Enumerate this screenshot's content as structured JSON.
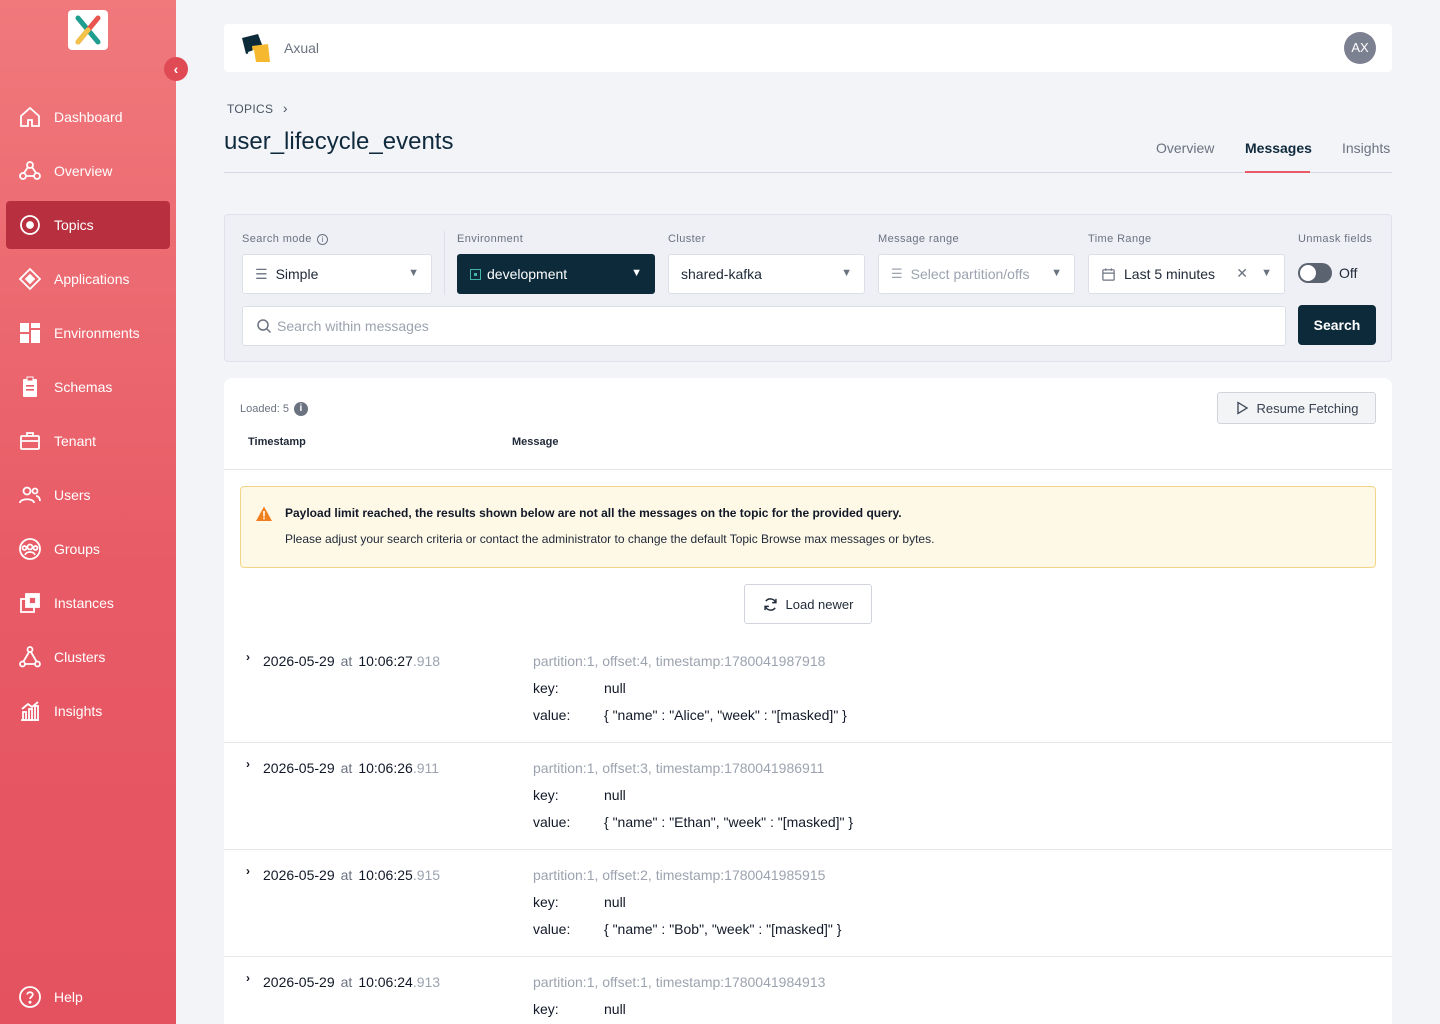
{
  "sidebar": {
    "items": [
      {
        "label": "Dashboard",
        "icon": "home-icon"
      },
      {
        "label": "Overview",
        "icon": "overview-icon"
      },
      {
        "label": "Topics",
        "icon": "topics-icon"
      },
      {
        "label": "Applications",
        "icon": "applications-icon"
      },
      {
        "label": "Environments",
        "icon": "environments-icon"
      },
      {
        "label": "Schemas",
        "icon": "schemas-icon"
      },
      {
        "label": "Tenant",
        "icon": "tenant-icon"
      },
      {
        "label": "Users",
        "icon": "users-icon"
      },
      {
        "label": "Groups",
        "icon": "groups-icon"
      },
      {
        "label": "Instances",
        "icon": "instances-icon"
      },
      {
        "label": "Clusters",
        "icon": "clusters-icon"
      },
      {
        "label": "Insights",
        "icon": "insights-icon"
      }
    ],
    "active": "Topics",
    "help_label": "Help",
    "collapse_glyph": "‹"
  },
  "header": {
    "brand": "Axual",
    "avatar_initials": "AX"
  },
  "breadcrumb": {
    "label": "TOPICS",
    "sep": "›"
  },
  "page": {
    "title": "user_lifecycle_events",
    "tabs": [
      {
        "label": "Overview"
      },
      {
        "label": "Messages"
      },
      {
        "label": "Insights"
      }
    ],
    "active_tab": "Messages"
  },
  "filters": {
    "search_mode": {
      "label": "Search mode",
      "value": "Simple"
    },
    "environment": {
      "label": "Environment",
      "value": "development"
    },
    "cluster": {
      "label": "Cluster",
      "value": "shared-kafka"
    },
    "message_range": {
      "label": "Message range",
      "placeholder": "Select partition/offs"
    },
    "time_range": {
      "label": "Time Range",
      "value": "Last 5 minutes"
    },
    "unmask": {
      "label": "Unmask fields",
      "state": "Off"
    },
    "search_placeholder": "Search within messages",
    "search_button": "Search"
  },
  "results": {
    "loaded_label": "Loaded: 5",
    "resume_button": "Resume Fetching",
    "col_timestamp": "Timestamp",
    "col_message": "Message",
    "warning": {
      "title": "Payload limit reached, the results shown below are not all the messages on the topic for the provided query.",
      "text": "Please adjust your search criteria or contact the administrator to change the default Topic Browse max messages or bytes."
    },
    "load_newer": "Load newer",
    "key_label": "key:",
    "value_label": "value:",
    "at_label": "at",
    "messages": [
      {
        "date": "2026-05-29",
        "time": "10:06:27",
        "ms": ".918",
        "meta": "partition:1, offset:4, timestamp:1780041987918",
        "key": "null",
        "value": "{ \"name\" : \"Alice\", \"week\" : \"[masked]\" }"
      },
      {
        "date": "2026-05-29",
        "time": "10:06:26",
        "ms": ".911",
        "meta": "partition:1, offset:3, timestamp:1780041986911",
        "key": "null",
        "value": "{ \"name\" : \"Ethan\", \"week\" : \"[masked]\" }"
      },
      {
        "date": "2026-05-29",
        "time": "10:06:25",
        "ms": ".915",
        "meta": "partition:1, offset:2, timestamp:1780041985915",
        "key": "null",
        "value": "{ \"name\" : \"Bob\", \"week\" : \"[masked]\" }"
      },
      {
        "date": "2026-05-29",
        "time": "10:06:24",
        "ms": ".913",
        "meta": "partition:1, offset:1, timestamp:1780041984913",
        "key": "null",
        "value": ""
      }
    ]
  },
  "colors": {
    "accent": "#e85b66",
    "dark": "#0d2a3a",
    "active_nav": "#b8303f"
  }
}
